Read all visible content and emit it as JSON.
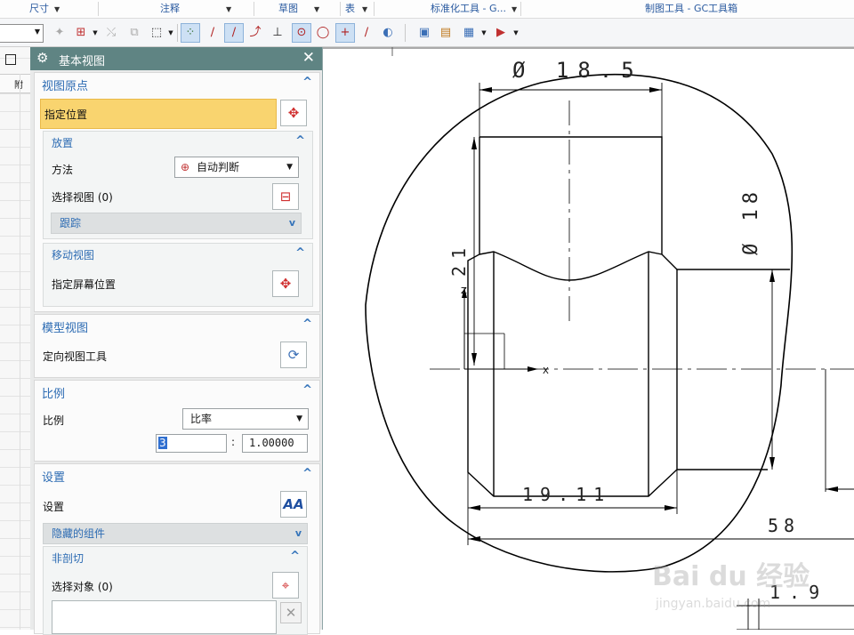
{
  "ribbon": {
    "groups": [
      {
        "label": "尺寸",
        "id": "dimension"
      },
      {
        "label": "注释",
        "id": "annotation"
      },
      {
        "label": "草图",
        "id": "sketch"
      },
      {
        "label": "表",
        "id": "table"
      },
      {
        "label": "标准化工具 - G...",
        "id": "std-tools"
      },
      {
        "label": "制图工具 - GC工具箱",
        "id": "drafting-tools"
      }
    ]
  },
  "left_strip": {
    "header": "附"
  },
  "dialog": {
    "title": "基本视图",
    "view_origin": {
      "header": "视图原点",
      "specify_location": "指定位置",
      "placement": {
        "header": "放置",
        "method_label": "方法",
        "method_value": "自动判断",
        "select_view_label": "选择视图 (0)",
        "trace_label": "跟踪"
      },
      "move_view": {
        "header": "移动视图",
        "screen_location_label": "指定屏幕位置"
      }
    },
    "model_view": {
      "header": "模型视图",
      "orient_tool_label": "定向视图工具"
    },
    "scale": {
      "header": "比例",
      "label": "比例",
      "value": "比率",
      "numerator": "3",
      "separator": ":",
      "denominator": "1.00000"
    },
    "settings": {
      "header": "设置",
      "label": "设置",
      "hidden_components": "隐藏的组件",
      "non_section": {
        "header": "非剖切",
        "select_objects_label": "选择对象 (0)"
      }
    }
  },
  "drawing": {
    "dim_diameter_top": "Ø 18.5",
    "dim_diameter_right": "Ø 18",
    "dim_height_21": "21",
    "dim_width_1911": "19.11",
    "dim_58": "58",
    "dim_19": "1.9",
    "axis_x": "X",
    "axis_z": "Z",
    "watermark_brand": "Bai du 经验",
    "watermark_url": "jingyan.baidu.com"
  }
}
